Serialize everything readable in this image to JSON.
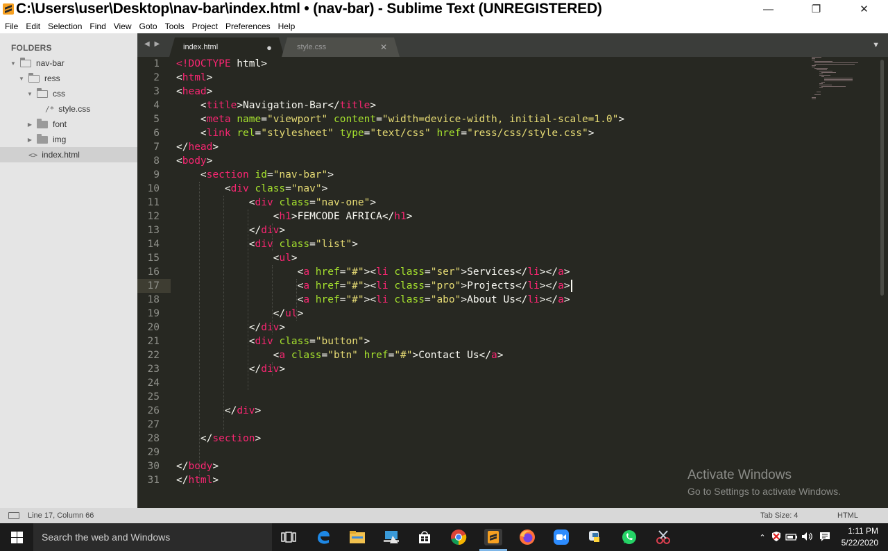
{
  "window": {
    "title": "C:\\Users\\user\\Desktop\\nav-bar\\index.html • (nav-bar) - Sublime Text (UNREGISTERED)",
    "minimize": "—",
    "maximize": "❐",
    "close": "✕"
  },
  "menu": [
    "File",
    "Edit",
    "Selection",
    "Find",
    "View",
    "Goto",
    "Tools",
    "Project",
    "Preferences",
    "Help"
  ],
  "sidebar": {
    "heading": "FOLDERS",
    "items": [
      {
        "label": "nav-bar",
        "type": "folder-open",
        "depth": 0
      },
      {
        "label": "ress",
        "type": "folder-open",
        "depth": 1
      },
      {
        "label": "css",
        "type": "folder-open",
        "depth": 2
      },
      {
        "label": "style.css",
        "type": "file",
        "glyph": "/*",
        "depth": 3
      },
      {
        "label": "font",
        "type": "folder-closed",
        "depth": 2
      },
      {
        "label": "img",
        "type": "folder-closed",
        "depth": 2
      },
      {
        "label": "index.html",
        "type": "file",
        "glyph": "<>",
        "depth": 1,
        "active": true
      }
    ]
  },
  "tabs": [
    {
      "label": "index.html",
      "indicator": "●",
      "active": true
    },
    {
      "label": "style.css",
      "indicator": "✕",
      "active": false
    }
  ],
  "tab_nav": "◀ ▶",
  "tab_dropdown": "▼",
  "editor": {
    "current_line": 17,
    "lines": [
      [
        [
          "tag",
          "<!DOCTYPE"
        ],
        [
          "txt",
          " html>"
        ]
      ],
      [
        [
          "txt",
          "<"
        ],
        [
          "tag",
          "html"
        ],
        [
          "txt",
          ">"
        ]
      ],
      [
        [
          "txt",
          "<"
        ],
        [
          "tag",
          "head"
        ],
        [
          "txt",
          ">"
        ]
      ],
      [
        [
          "txt",
          "    <"
        ],
        [
          "tag",
          "title"
        ],
        [
          "txt",
          ">Navigation-Bar</"
        ],
        [
          "tag",
          "title"
        ],
        [
          "txt",
          ">"
        ]
      ],
      [
        [
          "txt",
          "    <"
        ],
        [
          "tag",
          "meta"
        ],
        [
          "txt",
          " "
        ],
        [
          "attr",
          "name"
        ],
        [
          "txt",
          "="
        ],
        [
          "str",
          "\"viewport\""
        ],
        [
          "txt",
          " "
        ],
        [
          "attr",
          "content"
        ],
        [
          "txt",
          "="
        ],
        [
          "str",
          "\"width=device-width, initial-scale=1.0\""
        ],
        [
          "txt",
          ">"
        ]
      ],
      [
        [
          "txt",
          "    <"
        ],
        [
          "tag",
          "link"
        ],
        [
          "txt",
          " "
        ],
        [
          "attr",
          "rel"
        ],
        [
          "txt",
          "="
        ],
        [
          "str",
          "\"stylesheet\""
        ],
        [
          "txt",
          " "
        ],
        [
          "attr",
          "type"
        ],
        [
          "txt",
          "="
        ],
        [
          "str",
          "\"text/css\""
        ],
        [
          "txt",
          " "
        ],
        [
          "attr",
          "href"
        ],
        [
          "txt",
          "="
        ],
        [
          "str",
          "\"ress/css/style.css\""
        ],
        [
          "txt",
          ">"
        ]
      ],
      [
        [
          "txt",
          "</"
        ],
        [
          "tag",
          "head"
        ],
        [
          "txt",
          ">"
        ]
      ],
      [
        [
          "txt",
          "<"
        ],
        [
          "tag",
          "body"
        ],
        [
          "txt",
          ">"
        ]
      ],
      [
        [
          "txt",
          "    <"
        ],
        [
          "tag",
          "section"
        ],
        [
          "txt",
          " "
        ],
        [
          "attr",
          "id"
        ],
        [
          "txt",
          "="
        ],
        [
          "str",
          "\"nav-bar\""
        ],
        [
          "txt",
          ">"
        ]
      ],
      [
        [
          "txt",
          "        <"
        ],
        [
          "tag",
          "div"
        ],
        [
          "txt",
          " "
        ],
        [
          "attr",
          "class"
        ],
        [
          "txt",
          "="
        ],
        [
          "str",
          "\"nav\""
        ],
        [
          "txt",
          ">"
        ]
      ],
      [
        [
          "txt",
          "            <"
        ],
        [
          "tag",
          "div"
        ],
        [
          "txt",
          " "
        ],
        [
          "attr",
          "class"
        ],
        [
          "txt",
          "="
        ],
        [
          "str",
          "\"nav-one\""
        ],
        [
          "txt",
          ">"
        ]
      ],
      [
        [
          "txt",
          "                <"
        ],
        [
          "tag",
          "h1"
        ],
        [
          "txt",
          ">FEMCODE AFRICA</"
        ],
        [
          "tag",
          "h1"
        ],
        [
          "txt",
          ">"
        ]
      ],
      [
        [
          "txt",
          "            </"
        ],
        [
          "tag",
          "div"
        ],
        [
          "txt",
          ">"
        ]
      ],
      [
        [
          "txt",
          "            <"
        ],
        [
          "tag",
          "div"
        ],
        [
          "txt",
          " "
        ],
        [
          "attr",
          "class"
        ],
        [
          "txt",
          "="
        ],
        [
          "str",
          "\"list\""
        ],
        [
          "txt",
          ">"
        ]
      ],
      [
        [
          "txt",
          "                <"
        ],
        [
          "tag",
          "ul"
        ],
        [
          "txt",
          ">"
        ]
      ],
      [
        [
          "txt",
          "                    <"
        ],
        [
          "tag",
          "a"
        ],
        [
          "txt",
          " "
        ],
        [
          "attr",
          "href"
        ],
        [
          "txt",
          "="
        ],
        [
          "str",
          "\"#\""
        ],
        [
          "txt",
          "><"
        ],
        [
          "tag",
          "li"
        ],
        [
          "txt",
          " "
        ],
        [
          "attr",
          "class"
        ],
        [
          "txt",
          "="
        ],
        [
          "str",
          "\"ser\""
        ],
        [
          "txt",
          ">Services</"
        ],
        [
          "tag",
          "li"
        ],
        [
          "txt",
          "></"
        ],
        [
          "tag",
          "a"
        ],
        [
          "txt",
          ">"
        ]
      ],
      [
        [
          "txt",
          "                    <"
        ],
        [
          "tag",
          "a"
        ],
        [
          "txt",
          " "
        ],
        [
          "attr",
          "href"
        ],
        [
          "txt",
          "="
        ],
        [
          "str",
          "\"#\""
        ],
        [
          "txt",
          "><"
        ],
        [
          "tag",
          "li"
        ],
        [
          "txt",
          " "
        ],
        [
          "attr",
          "class"
        ],
        [
          "txt",
          "="
        ],
        [
          "str",
          "\"pro\""
        ],
        [
          "txt",
          ">Projects</"
        ],
        [
          "tag",
          "li"
        ],
        [
          "txt",
          "></"
        ],
        [
          "tag",
          "a"
        ],
        [
          "txt",
          ">"
        ]
      ],
      [
        [
          "txt",
          "                    <"
        ],
        [
          "tag",
          "a"
        ],
        [
          "txt",
          " "
        ],
        [
          "attr",
          "href"
        ],
        [
          "txt",
          "="
        ],
        [
          "str",
          "\"#\""
        ],
        [
          "txt",
          "><"
        ],
        [
          "tag",
          "li"
        ],
        [
          "txt",
          " "
        ],
        [
          "attr",
          "class"
        ],
        [
          "txt",
          "="
        ],
        [
          "str",
          "\"abo\""
        ],
        [
          "txt",
          ">About Us</"
        ],
        [
          "tag",
          "li"
        ],
        [
          "txt",
          "></"
        ],
        [
          "tag",
          "a"
        ],
        [
          "txt",
          ">"
        ]
      ],
      [
        [
          "txt",
          "                </"
        ],
        [
          "tag",
          "ul"
        ],
        [
          "txt",
          ">"
        ]
      ],
      [
        [
          "txt",
          "            </"
        ],
        [
          "tag",
          "div"
        ],
        [
          "txt",
          ">"
        ]
      ],
      [
        [
          "txt",
          "            <"
        ],
        [
          "tag",
          "div"
        ],
        [
          "txt",
          " "
        ],
        [
          "attr",
          "class"
        ],
        [
          "txt",
          "="
        ],
        [
          "str",
          "\"button\""
        ],
        [
          "txt",
          ">"
        ]
      ],
      [
        [
          "txt",
          "                <"
        ],
        [
          "tag",
          "a"
        ],
        [
          "txt",
          " "
        ],
        [
          "attr",
          "class"
        ],
        [
          "txt",
          "="
        ],
        [
          "str",
          "\"btn\""
        ],
        [
          "txt",
          " "
        ],
        [
          "attr",
          "href"
        ],
        [
          "txt",
          "="
        ],
        [
          "str",
          "\"#\""
        ],
        [
          "txt",
          ">Contact Us</"
        ],
        [
          "tag",
          "a"
        ],
        [
          "txt",
          ">"
        ]
      ],
      [
        [
          "txt",
          "            </"
        ],
        [
          "tag",
          "div"
        ],
        [
          "txt",
          ">"
        ]
      ],
      [
        [
          "txt",
          ""
        ]
      ],
      [
        [
          "txt",
          ""
        ]
      ],
      [
        [
          "txt",
          "        </"
        ],
        [
          "tag",
          "div"
        ],
        [
          "txt",
          ">"
        ]
      ],
      [
        [
          "txt",
          ""
        ]
      ],
      [
        [
          "txt",
          "    </"
        ],
        [
          "tag",
          "section"
        ],
        [
          "txt",
          ">"
        ]
      ],
      [
        [
          "txt",
          ""
        ]
      ],
      [
        [
          "txt",
          "</"
        ],
        [
          "tag",
          "body"
        ],
        [
          "txt",
          ">"
        ]
      ],
      [
        [
          "txt",
          "</"
        ],
        [
          "tag",
          "html"
        ],
        [
          "txt",
          ">"
        ]
      ]
    ],
    "watermark_title": "Activate Windows",
    "watermark_subtitle": "Go to Settings to activate Windows."
  },
  "status": {
    "position": "Line 17, Column 66",
    "tab_size": "Tab Size: 4",
    "syntax": "HTML"
  },
  "taskbar": {
    "search_placeholder": "Search the web and Windows",
    "time": "1:11 PM",
    "date": "5/22/2020"
  },
  "colors": {
    "editor_bg": "#272822",
    "tag": "#f92672",
    "attr": "#a6e22e",
    "string": "#e6db74",
    "text": "#f8f8f2"
  }
}
